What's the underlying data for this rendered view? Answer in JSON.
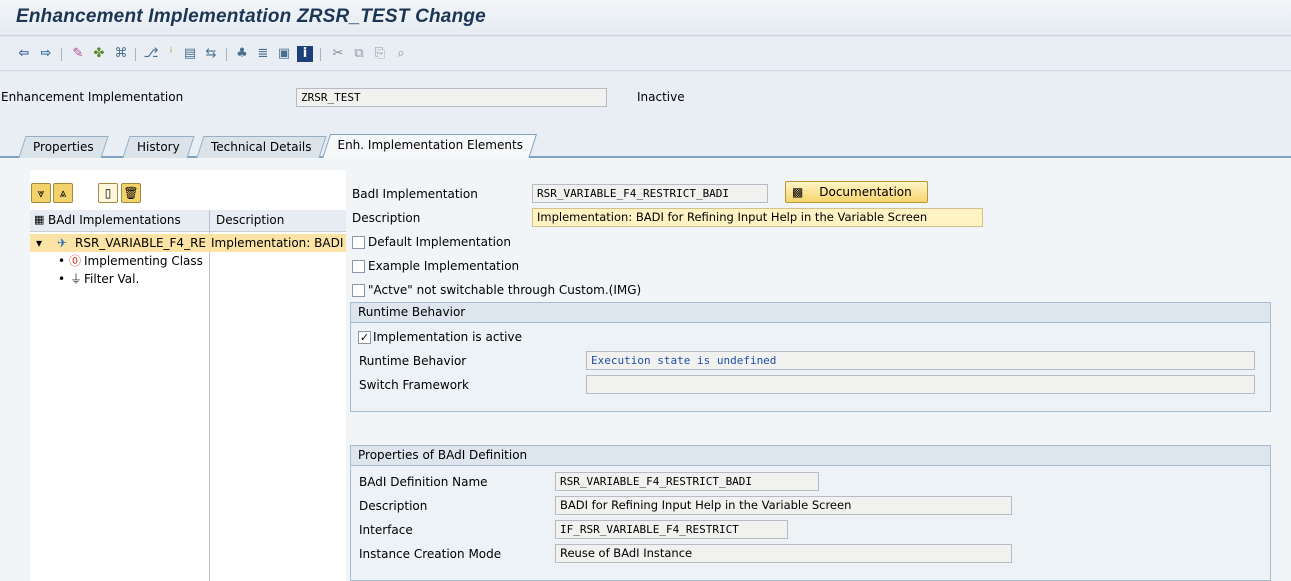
{
  "window": {
    "title": "Enhancement Implementation ZRSR_TEST Change"
  },
  "toolbar": {
    "icons": [
      "back-icon",
      "forward-icon",
      "edit-icon",
      "activate-icon",
      "object-list-icon",
      "where-used-icon",
      "info-icon",
      "display-icon",
      "navigate-icon",
      "hierarchy-icon",
      "layout-icon",
      "window-icon",
      "help-icon",
      "cut-icon",
      "copy-icon",
      "paste-icon",
      "find-icon"
    ]
  },
  "header": {
    "impl_label": "Enhancement Implementation",
    "impl_value": "ZRSR_TEST",
    "status": "Inactive"
  },
  "tabs": [
    {
      "label": "Properties"
    },
    {
      "label": "History"
    },
    {
      "label": "Technical Details"
    },
    {
      "label": "Enh. Implementation Elements"
    }
  ],
  "tree": {
    "col1": "BAdI Implementations",
    "col2": "Description",
    "root": {
      "label": "RSR_VARIABLE_F4_RE",
      "desc": "Implementation: BADI"
    },
    "children": [
      {
        "label": "Implementing Class"
      },
      {
        "label": "Filter Val."
      }
    ]
  },
  "detail": {
    "badi_impl_label": "BadI Implementation",
    "badi_impl_value": "RSR_VARIABLE_F4_RESTRICT_BADI",
    "documentation_btn": "Documentation",
    "description_label": "Description",
    "description_value": "Implementation: BADI for Refining Input Help in the Variable Screen",
    "default_impl": "Default Implementation",
    "example_impl": "Example Implementation",
    "not_switchable": "\"Actve\" not switchable through Custom.(IMG)"
  },
  "runtime": {
    "title": "Runtime Behavior",
    "active_label": "Implementation is active",
    "active_checked": true,
    "rb_label": "Runtime Behavior",
    "rb_value": "Execution state is undefined",
    "sf_label": "Switch Framework",
    "sf_value": ""
  },
  "definition": {
    "title": "Properties of BAdI Definition",
    "name_label": "BAdI Definition Name",
    "name_value": "RSR_VARIABLE_F4_RESTRICT_BADI",
    "desc_label": "Description",
    "desc_value": "BADI for Refining Input Help in the Variable Screen",
    "intf_label": "Interface",
    "intf_value": "IF_RSR_VARIABLE_F4_RESTRICT",
    "mode_label": "Instance Creation Mode",
    "mode_value": "Reuse of BAdI Instance"
  }
}
